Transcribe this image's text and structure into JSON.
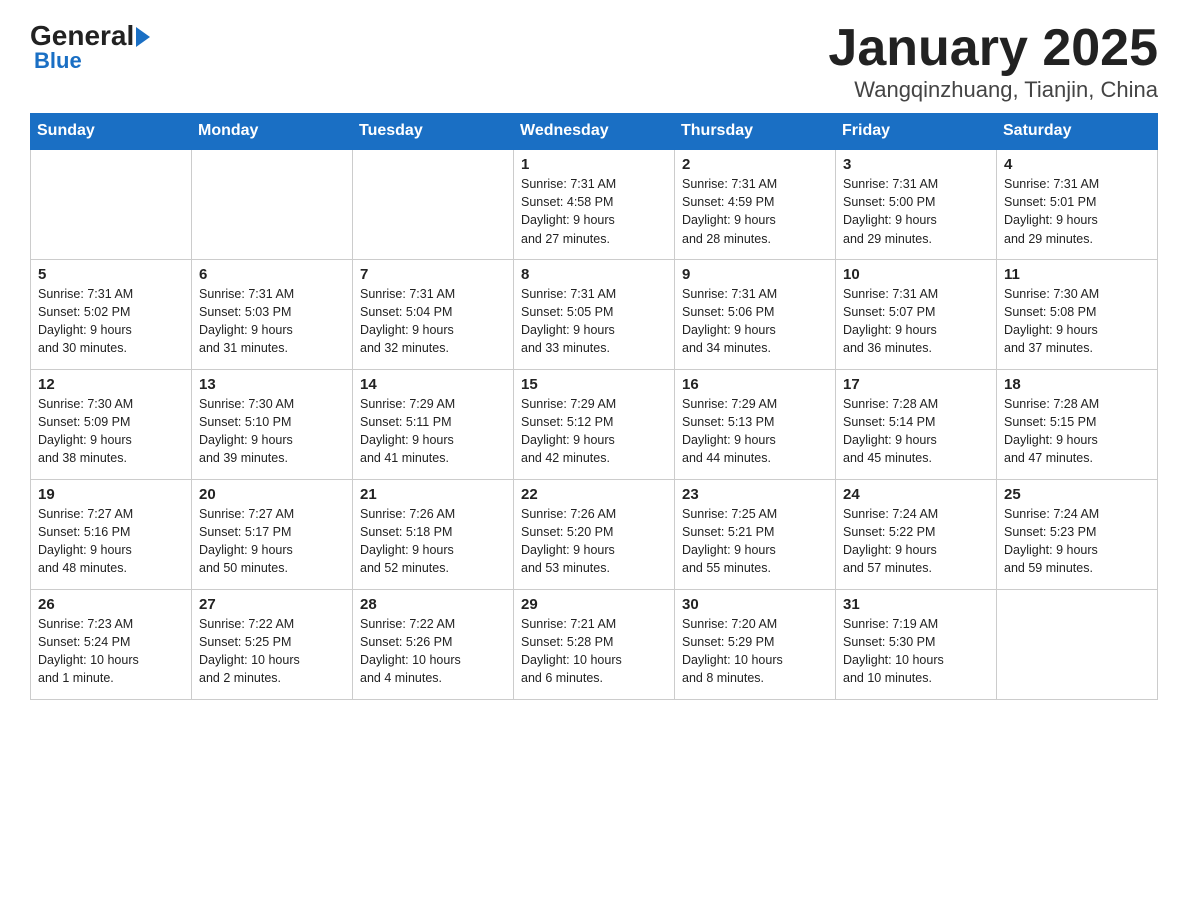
{
  "logo": {
    "text_part1": "General",
    "text_part2": "Blue"
  },
  "title": "January 2025",
  "subtitle": "Wangqinzhuang, Tianjin, China",
  "weekdays": [
    "Sunday",
    "Monday",
    "Tuesday",
    "Wednesday",
    "Thursday",
    "Friday",
    "Saturday"
  ],
  "weeks": [
    [
      {
        "day": "",
        "info": ""
      },
      {
        "day": "",
        "info": ""
      },
      {
        "day": "",
        "info": ""
      },
      {
        "day": "1",
        "info": "Sunrise: 7:31 AM\nSunset: 4:58 PM\nDaylight: 9 hours\nand 27 minutes."
      },
      {
        "day": "2",
        "info": "Sunrise: 7:31 AM\nSunset: 4:59 PM\nDaylight: 9 hours\nand 28 minutes."
      },
      {
        "day": "3",
        "info": "Sunrise: 7:31 AM\nSunset: 5:00 PM\nDaylight: 9 hours\nand 29 minutes."
      },
      {
        "day": "4",
        "info": "Sunrise: 7:31 AM\nSunset: 5:01 PM\nDaylight: 9 hours\nand 29 minutes."
      }
    ],
    [
      {
        "day": "5",
        "info": "Sunrise: 7:31 AM\nSunset: 5:02 PM\nDaylight: 9 hours\nand 30 minutes."
      },
      {
        "day": "6",
        "info": "Sunrise: 7:31 AM\nSunset: 5:03 PM\nDaylight: 9 hours\nand 31 minutes."
      },
      {
        "day": "7",
        "info": "Sunrise: 7:31 AM\nSunset: 5:04 PM\nDaylight: 9 hours\nand 32 minutes."
      },
      {
        "day": "8",
        "info": "Sunrise: 7:31 AM\nSunset: 5:05 PM\nDaylight: 9 hours\nand 33 minutes."
      },
      {
        "day": "9",
        "info": "Sunrise: 7:31 AM\nSunset: 5:06 PM\nDaylight: 9 hours\nand 34 minutes."
      },
      {
        "day": "10",
        "info": "Sunrise: 7:31 AM\nSunset: 5:07 PM\nDaylight: 9 hours\nand 36 minutes."
      },
      {
        "day": "11",
        "info": "Sunrise: 7:30 AM\nSunset: 5:08 PM\nDaylight: 9 hours\nand 37 minutes."
      }
    ],
    [
      {
        "day": "12",
        "info": "Sunrise: 7:30 AM\nSunset: 5:09 PM\nDaylight: 9 hours\nand 38 minutes."
      },
      {
        "day": "13",
        "info": "Sunrise: 7:30 AM\nSunset: 5:10 PM\nDaylight: 9 hours\nand 39 minutes."
      },
      {
        "day": "14",
        "info": "Sunrise: 7:29 AM\nSunset: 5:11 PM\nDaylight: 9 hours\nand 41 minutes."
      },
      {
        "day": "15",
        "info": "Sunrise: 7:29 AM\nSunset: 5:12 PM\nDaylight: 9 hours\nand 42 minutes."
      },
      {
        "day": "16",
        "info": "Sunrise: 7:29 AM\nSunset: 5:13 PM\nDaylight: 9 hours\nand 44 minutes."
      },
      {
        "day": "17",
        "info": "Sunrise: 7:28 AM\nSunset: 5:14 PM\nDaylight: 9 hours\nand 45 minutes."
      },
      {
        "day": "18",
        "info": "Sunrise: 7:28 AM\nSunset: 5:15 PM\nDaylight: 9 hours\nand 47 minutes."
      }
    ],
    [
      {
        "day": "19",
        "info": "Sunrise: 7:27 AM\nSunset: 5:16 PM\nDaylight: 9 hours\nand 48 minutes."
      },
      {
        "day": "20",
        "info": "Sunrise: 7:27 AM\nSunset: 5:17 PM\nDaylight: 9 hours\nand 50 minutes."
      },
      {
        "day": "21",
        "info": "Sunrise: 7:26 AM\nSunset: 5:18 PM\nDaylight: 9 hours\nand 52 minutes."
      },
      {
        "day": "22",
        "info": "Sunrise: 7:26 AM\nSunset: 5:20 PM\nDaylight: 9 hours\nand 53 minutes."
      },
      {
        "day": "23",
        "info": "Sunrise: 7:25 AM\nSunset: 5:21 PM\nDaylight: 9 hours\nand 55 minutes."
      },
      {
        "day": "24",
        "info": "Sunrise: 7:24 AM\nSunset: 5:22 PM\nDaylight: 9 hours\nand 57 minutes."
      },
      {
        "day": "25",
        "info": "Sunrise: 7:24 AM\nSunset: 5:23 PM\nDaylight: 9 hours\nand 59 minutes."
      }
    ],
    [
      {
        "day": "26",
        "info": "Sunrise: 7:23 AM\nSunset: 5:24 PM\nDaylight: 10 hours\nand 1 minute."
      },
      {
        "day": "27",
        "info": "Sunrise: 7:22 AM\nSunset: 5:25 PM\nDaylight: 10 hours\nand 2 minutes."
      },
      {
        "day": "28",
        "info": "Sunrise: 7:22 AM\nSunset: 5:26 PM\nDaylight: 10 hours\nand 4 minutes."
      },
      {
        "day": "29",
        "info": "Sunrise: 7:21 AM\nSunset: 5:28 PM\nDaylight: 10 hours\nand 6 minutes."
      },
      {
        "day": "30",
        "info": "Sunrise: 7:20 AM\nSunset: 5:29 PM\nDaylight: 10 hours\nand 8 minutes."
      },
      {
        "day": "31",
        "info": "Sunrise: 7:19 AM\nSunset: 5:30 PM\nDaylight: 10 hours\nand 10 minutes."
      },
      {
        "day": "",
        "info": ""
      }
    ]
  ]
}
